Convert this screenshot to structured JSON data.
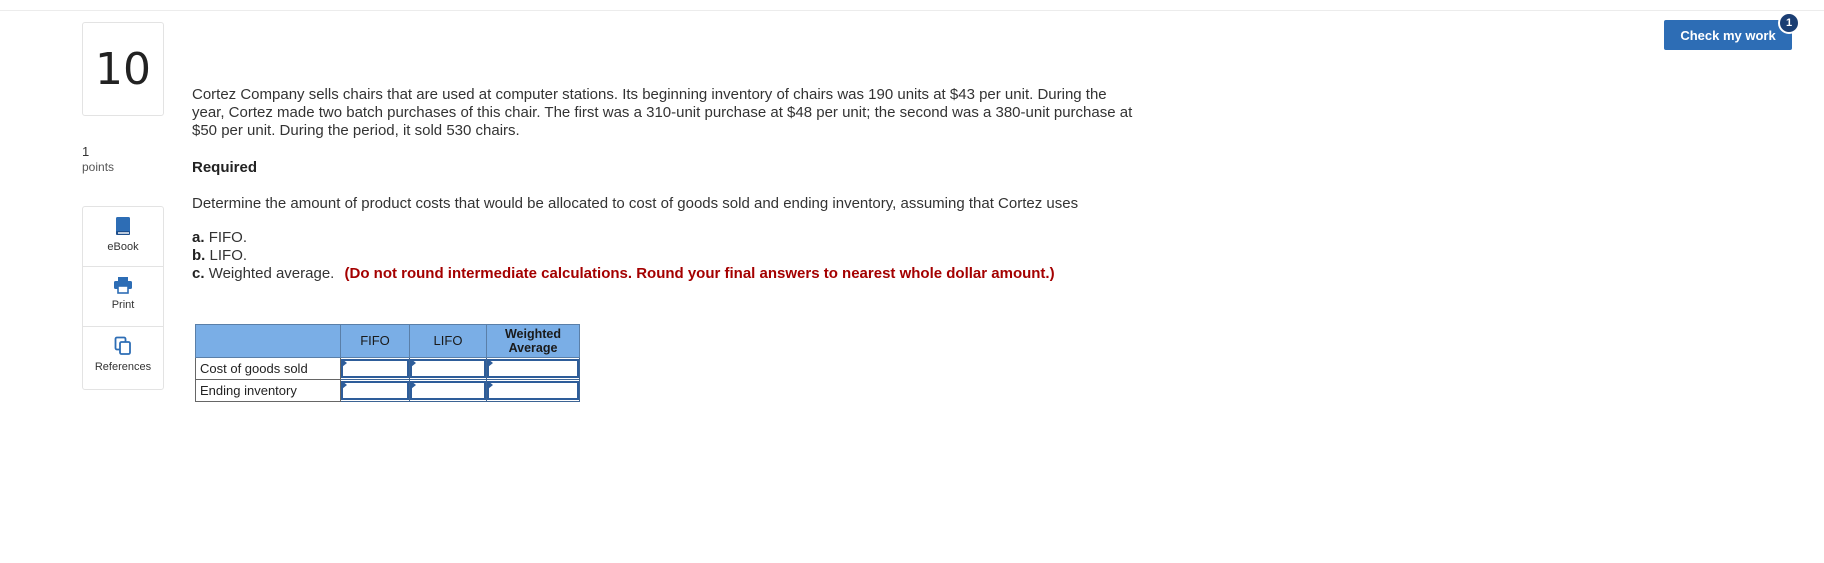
{
  "question": {
    "number": "10",
    "points_value": "1",
    "points_label": "points"
  },
  "tools": [
    {
      "label": "eBook",
      "icon": "book-icon"
    },
    {
      "label": "Print",
      "icon": "printer-icon"
    },
    {
      "label": "References",
      "icon": "copy-icon"
    }
  ],
  "header": {
    "check_label": "Check my work",
    "badge_count": "1"
  },
  "problem": {
    "text": "Cortez Company sells chairs that are used at computer stations. Its beginning inventory of chairs was 190 units at $43 per unit. During the year, Cortez made two batch purchases of this chair. The first was a 310-unit purchase at $48 per unit; the second was a 380-unit purchase at $50 per unit. During the period, it sold 530 chairs.",
    "required_label": "Required",
    "determine": "Determine the amount of product costs that would be allocated to cost of goods sold and ending inventory, assuming that Cortez uses",
    "options": [
      {
        "letter": "a.",
        "text": "FIFO."
      },
      {
        "letter": "b.",
        "text": "LIFO."
      },
      {
        "letter": "c.",
        "text": "Weighted average."
      }
    ],
    "instruction": "(Do not round intermediate calculations. Round your final answers to nearest whole dollar amount.)"
  },
  "table": {
    "columns": [
      "FIFO",
      "LIFO",
      "Weighted Average"
    ],
    "rows": [
      {
        "label": "Cost of goods sold",
        "values": [
          "",
          "",
          ""
        ]
      },
      {
        "label": "Ending inventory",
        "values": [
          "",
          "",
          ""
        ]
      }
    ]
  },
  "colors": {
    "accent": "#2d6db5",
    "header_bg": "#7aaee6",
    "warning": "#a40000",
    "badge": "#1b3e73"
  }
}
